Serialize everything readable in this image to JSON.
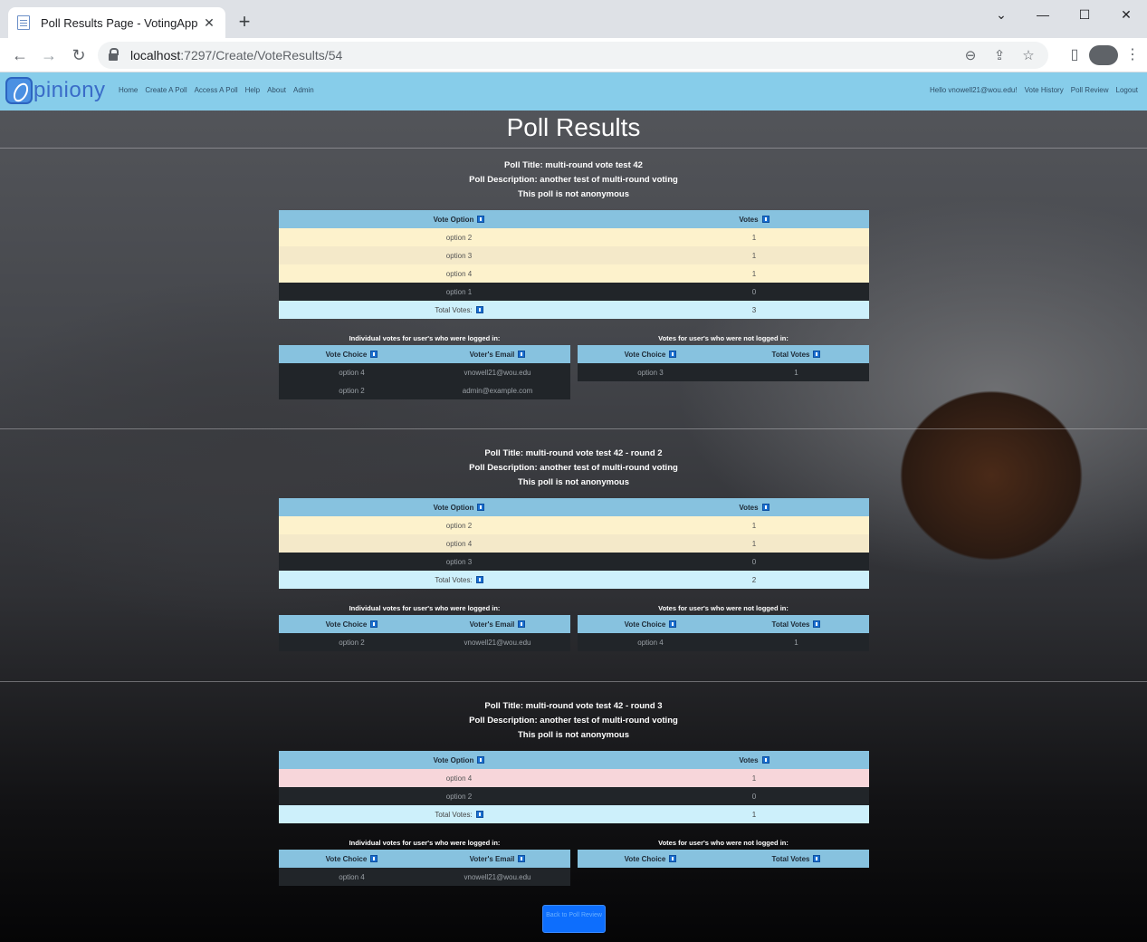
{
  "browser": {
    "tab_title": "Poll Results Page - VotingApp",
    "url_host": "localhost",
    "url_path": ":7297/Create/VoteResults/54"
  },
  "navbar": {
    "logo_text": "piniony",
    "left_links": [
      "Home",
      "Create A Poll",
      "Access A Poll",
      "Help",
      "About",
      "Admin"
    ],
    "right_links": [
      "Hello vnowell21@wou.edu!",
      "Vote History",
      "Poll Review",
      "Logout"
    ]
  },
  "page_title": "Poll Results",
  "headers": {
    "vote_option": "Vote Option",
    "votes": "Votes",
    "total_votes_label": "Total Votes:",
    "logged_caption": "Individual votes for user's who were logged in:",
    "not_logged_caption": "Votes for user's who were not logged in:",
    "vote_choice": "Vote Choice",
    "voter_email": "Voter's Email",
    "total_votes": "Total Votes"
  },
  "polls": [
    {
      "title": "Poll Title: multi-round vote test 42",
      "description": "Poll Description: another test of multi-round voting",
      "anonymity": "This poll is not anonymous",
      "results": [
        {
          "option": "option 2",
          "votes": "1"
        },
        {
          "option": "option 3",
          "votes": "1"
        },
        {
          "option": "option 4",
          "votes": "1"
        },
        {
          "option": "option 1",
          "votes": "0"
        }
      ],
      "total": "3",
      "logged_in": [
        {
          "choice": "option 4",
          "email": "vnowell21@wou.edu"
        },
        {
          "choice": "option 2",
          "email": "admin@example.com"
        }
      ],
      "not_logged_in": [
        {
          "choice": "option 3",
          "total": "1"
        }
      ]
    },
    {
      "title": "Poll Title: multi-round vote test 42 - round 2",
      "description": "Poll Description: another test of multi-round voting",
      "anonymity": "This poll is not anonymous",
      "results": [
        {
          "option": "option 2",
          "votes": "1"
        },
        {
          "option": "option 4",
          "votes": "1"
        },
        {
          "option": "option 3",
          "votes": "0"
        }
      ],
      "total": "2",
      "logged_in": [
        {
          "choice": "option 2",
          "email": "vnowell21@wou.edu"
        }
      ],
      "not_logged_in": [
        {
          "choice": "option 4",
          "total": "1"
        }
      ]
    },
    {
      "title": "Poll Title: multi-round vote test 42 - round 3",
      "description": "Poll Description: another test of multi-round voting",
      "anonymity": "This poll is not anonymous",
      "results": [
        {
          "option": "option 4",
          "votes": "1"
        },
        {
          "option": "option 2",
          "votes": "0"
        }
      ],
      "total": "1",
      "logged_in": [
        {
          "choice": "option 4",
          "email": "vnowell21@wou.edu"
        }
      ],
      "not_logged_in": []
    }
  ],
  "back_button": "Back to Poll Review",
  "colors": {
    "navbar": "#87cdea",
    "table_header": "#87c2df",
    "winner_row": "#fdf2cc",
    "single_winner_row": "#f7d6da",
    "zero_row": "#212529",
    "total_row": "#cdf0fb",
    "button": "#0d6efd"
  }
}
